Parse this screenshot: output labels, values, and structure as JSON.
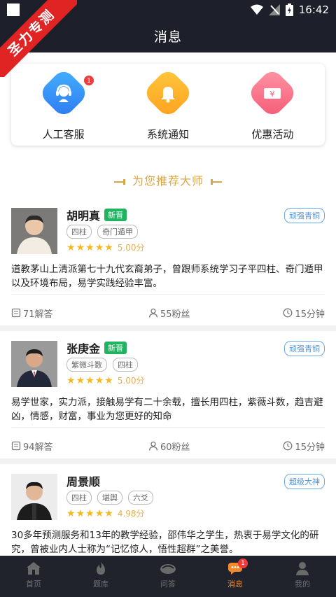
{
  "status": {
    "time": "16:42"
  },
  "ribbon": "圣力专测",
  "header": {
    "title": "消息"
  },
  "quick_actions": [
    {
      "label": "人工客服",
      "icon": "customer-service-icon",
      "badge": "1",
      "color": "#3a8ff5"
    },
    {
      "label": "系统通知",
      "icon": "bell-icon",
      "color": "#ffb12e"
    },
    {
      "label": "优惠活动",
      "icon": "coupon-icon",
      "color": "#f7728a"
    }
  ],
  "section_title": "为您推荐大师",
  "masters": [
    {
      "name": "胡明真",
      "new_tag": "新晋",
      "rank": "顽强青铜",
      "tags": [
        "四柱",
        "奇门遁甲"
      ],
      "stars": 5,
      "score": "5.00分",
      "desc": "道教茅山上清派第七十九代玄裔弟子，曾跟师系统学习子平四柱、奇门遁甲以及环境布局，易学实践经验丰富。",
      "answers": "71解答",
      "fans": "55粉丝",
      "time": "15分钟"
    },
    {
      "name": "张庚金",
      "new_tag": "新晋",
      "rank": "顽强青铜",
      "tags": [
        "紫微斗数",
        "四柱"
      ],
      "stars": 5,
      "score": "5.00分",
      "desc": "易学世家，实力派，接触易学有二十余载，擅长用四柱，紫薇斗数，趋吉避凶，情感，财富，事业为您更好的知命",
      "answers": "94解答",
      "fans": "60粉丝",
      "time": "15分钟"
    },
    {
      "name": "周景顺",
      "rank": "超级大神",
      "tags": [
        "四柱",
        "堪舆",
        "六爻"
      ],
      "stars": 5,
      "score": "4.98分",
      "desc": "30多年预测服务和13年的教学经验，邵伟华之学生，热衷于易学文化的研究，曾被业内人士称为“记忆惊人，悟性超群”之美誉。"
    }
  ],
  "tabs": [
    {
      "label": "首页",
      "icon": "home-icon"
    },
    {
      "label": "题库",
      "icon": "flame-icon"
    },
    {
      "label": "问答",
      "icon": "qa-icon"
    },
    {
      "label": "消息",
      "icon": "message-icon",
      "badge": "1",
      "active": true
    },
    {
      "label": "我的",
      "icon": "profile-icon"
    }
  ],
  "colors": {
    "dark": "#1d1f2a",
    "accent": "#f08a2c",
    "gold": "#d7a64a",
    "green": "#21b35f",
    "rank_blue": "#4f94dc"
  }
}
